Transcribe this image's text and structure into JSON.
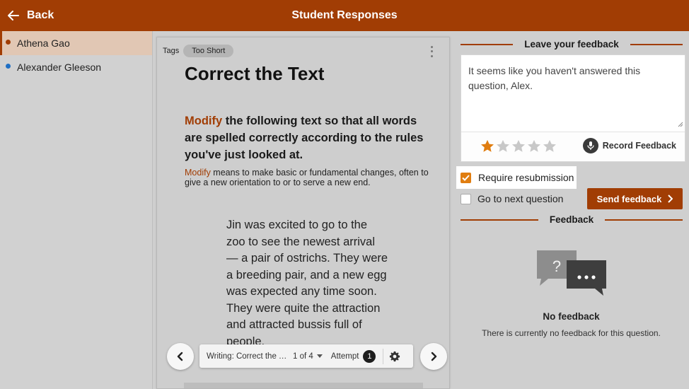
{
  "header": {
    "back_label": "Back",
    "title": "Student Responses"
  },
  "students": [
    {
      "name": "Athena Gao",
      "dot_color": "#a13d04",
      "active": true
    },
    {
      "name": "Alexander Gleeson",
      "dot_color": "#1f6fc4",
      "active": false
    }
  ],
  "question": {
    "tags_label": "Tags",
    "tag": "Too Short",
    "title": "Correct the Text",
    "instruction_keyword": "Modify",
    "instruction_rest": " the following text so that all words are spelled correctly according to the rules you've just looked at.",
    "definition_keyword": "Modify",
    "definition_rest": " means to make basic or fundamental changes, often to give a new orientation to or to serve a new end.",
    "passage": "Jin was excited to go to the zoo to see the newest arrival — a pair of ostrichs. They were a breeding pair, and a new egg was expected any time soon. They were quite the attraction and attracted bussis full of people."
  },
  "navigator": {
    "question_name": "Writing: Correct the Te...",
    "page": "1 of 4",
    "attempt_label": "Attempt",
    "attempt_number": "1"
  },
  "feedback_form": {
    "heading": "Leave your feedback",
    "text": "It seems like you haven't answered this question, Alex.",
    "rating": 1,
    "max_rating": 5,
    "record_label": "Record Feedback",
    "require_resubmission_label": "Require resubmission",
    "require_resubmission_checked": true,
    "go_next_label": "Go to next question",
    "go_next_checked": false,
    "send_label": "Send feedback"
  },
  "feedback_history": {
    "heading": "Feedback",
    "empty_title": "No feedback",
    "empty_message": "There is currently no feedback for this question."
  },
  "colors": {
    "brand": "#a13d04",
    "star_on": "#e07d10",
    "star_off": "#c8c8c8",
    "checkbox": "#e07d10"
  }
}
